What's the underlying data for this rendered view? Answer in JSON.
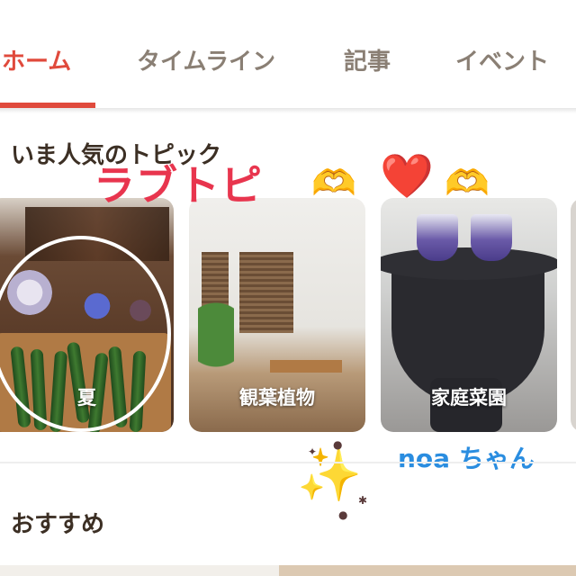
{
  "tabs": [
    {
      "label": "ホーム",
      "active": true
    },
    {
      "label": "タイムライン",
      "active": false
    },
    {
      "label": "記事",
      "active": false
    },
    {
      "label": "イベント",
      "active": false
    }
  ],
  "sections": {
    "popular_topics": "いま人気のトピック",
    "recommended": "おすすめ"
  },
  "topic_cards": [
    {
      "label": "夏"
    },
    {
      "label": "観葉植物"
    },
    {
      "label": "家庭菜園"
    }
  ],
  "stickers": {
    "love_text": "ラブトピ",
    "heart_hands": "🫶",
    "heart": "❤️",
    "sparkles": "✨",
    "name_text": "noa ちゃん"
  },
  "colors": {
    "accent": "#e04a3c",
    "tab_inactive": "#8a7f74",
    "title": "#3c2f24",
    "sticker_pink": "#e8354e",
    "sticker_blue": "#2a8de0"
  }
}
